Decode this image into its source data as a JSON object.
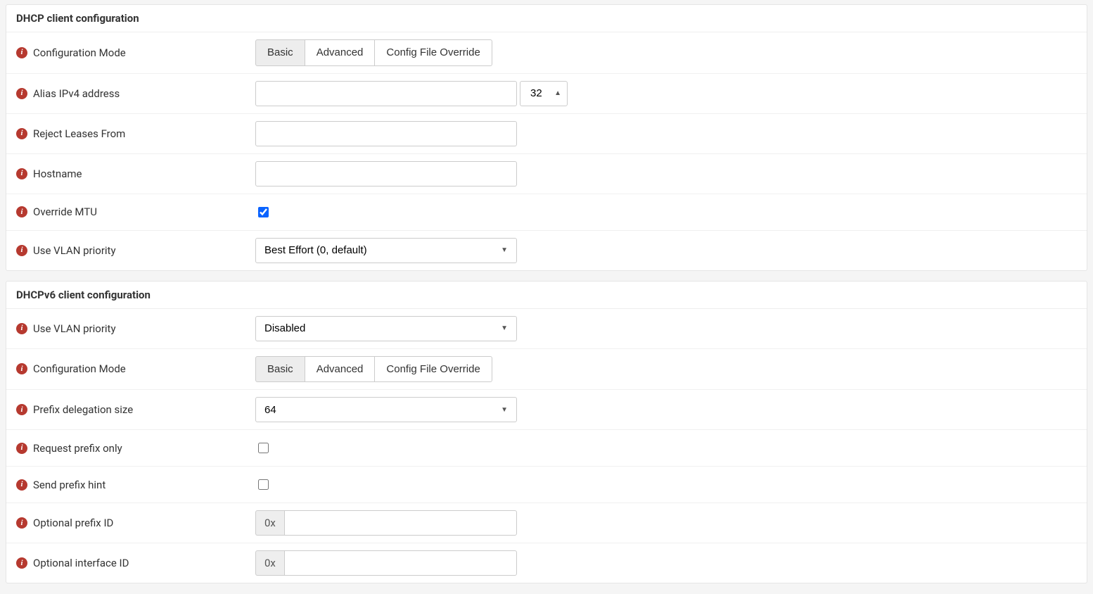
{
  "sections": {
    "dhcp4": {
      "title": "DHCP client configuration",
      "rows": {
        "config_mode": {
          "label": "Configuration Mode",
          "options": [
            "Basic",
            "Advanced",
            "Config File Override"
          ],
          "selected": "Basic"
        },
        "alias_ipv4": {
          "label": "Alias IPv4 address",
          "value": "",
          "cidr": "32"
        },
        "reject_leases": {
          "label": "Reject Leases From",
          "value": ""
        },
        "hostname": {
          "label": "Hostname",
          "value": ""
        },
        "override_mtu": {
          "label": "Override MTU",
          "checked": true
        },
        "vlan_prio": {
          "label": "Use VLAN priority",
          "value": "Best Effort (0, default)"
        }
      }
    },
    "dhcp6": {
      "title": "DHCPv6 client configuration",
      "rows": {
        "vlan_prio": {
          "label": "Use VLAN priority",
          "value": "Disabled"
        },
        "config_mode": {
          "label": "Configuration Mode",
          "options": [
            "Basic",
            "Advanced",
            "Config File Override"
          ],
          "selected": "Basic"
        },
        "prefix_delegation": {
          "label": "Prefix delegation size",
          "value": "64"
        },
        "request_prefix": {
          "label": "Request prefix only",
          "checked": false
        },
        "send_prefix_hint": {
          "label": "Send prefix hint",
          "checked": false
        },
        "optional_prefix_id": {
          "label": "Optional prefix ID",
          "addon": "0x",
          "value": ""
        },
        "optional_interface_id": {
          "label": "Optional interface ID",
          "addon": "0x",
          "value": ""
        }
      }
    }
  }
}
